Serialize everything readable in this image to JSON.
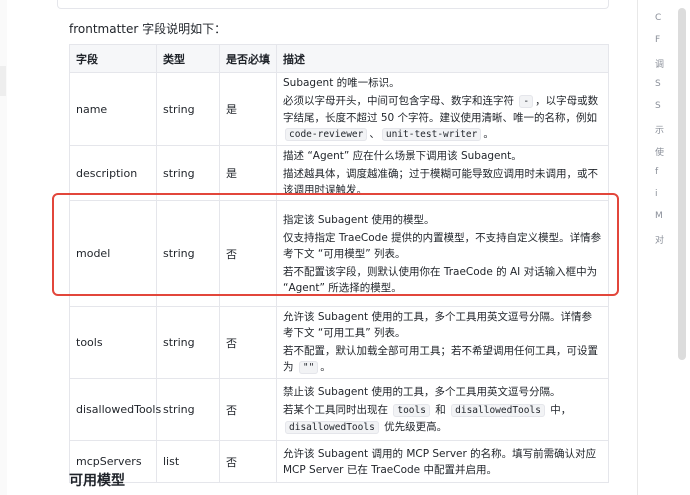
{
  "intro": "frontmatter 字段说明如下：",
  "table": {
    "headers": [
      "字段",
      "类型",
      "是否必填",
      "描述"
    ],
    "rows": [
      {
        "field": "name",
        "type": "string",
        "required": "是",
        "desc": [
          [
            {
              "t": "Subagent 的唯一标识。"
            }
          ],
          [
            {
              "t": "必须以字母开头，中间可包含字母、数字和连字符 "
            },
            {
              "c": "-"
            },
            {
              "t": "，以字母或数字结尾，长度不超过 50 个字符。建议使用清晰、唯一的名称，例如 "
            },
            {
              "c": "code-reviewer"
            },
            {
              "t": "、"
            },
            {
              "c": "unit-test-writer"
            },
            {
              "t": "。"
            }
          ]
        ]
      },
      {
        "field": "description",
        "type": "string",
        "required": "是",
        "desc": [
          [
            {
              "t": "描述 “Agent” 应在什么场景下调用该 Subagent。"
            }
          ],
          [
            {
              "t": "描述越具体，调度越准确；过于模糊可能导致应调用时未调用，或不该调用时误触发。"
            }
          ]
        ]
      },
      {
        "field": "model",
        "type": "string",
        "required": "否",
        "desc": [
          [
            {
              "t": "指定该 Subagent 使用的模型。"
            }
          ],
          [
            {
              "t": "仅支持指定 TraeCode 提供的内置模型，不支持自定义模型。详情参考下文 “可用模型” 列表。"
            }
          ],
          [
            {
              "t": "若不配置该字段，则默认使用你在 TraeCode 的 AI 对话输入框中为 “Agent” 所选择的模型。"
            }
          ]
        ]
      },
      {
        "field": "tools",
        "type": "string",
        "required": "否",
        "desc": [
          [
            {
              "t": "允许该 Subagent 使用的工具，多个工具用英文逗号分隔。详情参考下文 “可用工具” 列表。"
            }
          ],
          [
            {
              "t": "若不配置，默认加载全部可用工具；若不希望调用任何工具，可设置为 "
            },
            {
              "c": "\"\""
            },
            {
              "t": "。"
            }
          ]
        ]
      },
      {
        "field": "disallowedTools",
        "type": "string",
        "required": "否",
        "desc": [
          [
            {
              "t": "禁止该 Subagent 使用的工具，多个工具用英文逗号分隔。"
            }
          ],
          [
            {
              "t": "若某个工具同时出现在 "
            },
            {
              "c": "tools"
            },
            {
              "t": " 和 "
            },
            {
              "c": "disallowedTools"
            },
            {
              "t": " 中，"
            },
            {
              "c": "disallowedTools"
            },
            {
              "t": " 优先级更高。"
            }
          ]
        ]
      },
      {
        "field": "mcpServers",
        "type": "list",
        "required": "否",
        "desc": [
          [
            {
              "t": "允许该 Subagent 调用的 MCP Server 的名称。填写前需确认对应 MCP Server 已在 TraeCode 中配置并启用。"
            }
          ]
        ]
      }
    ]
  },
  "section_title": "可用模型",
  "toc": [
    "C",
    "F",
    "调",
    "S",
    "S",
    "示",
    "使",
    "f",
    "i",
    "M",
    "对"
  ]
}
